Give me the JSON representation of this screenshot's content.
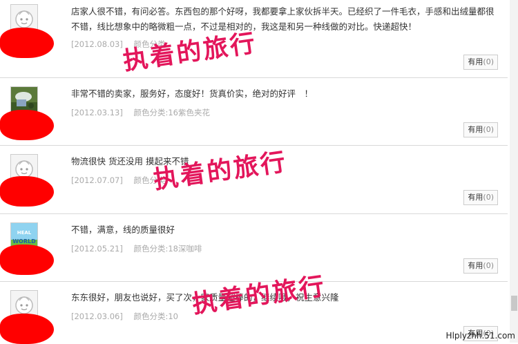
{
  "reviews": [
    {
      "text": "店家人很不错，有问必答。东西包的那个好呀，我都要拿上家伙拆半天。已经织了一件毛衣，手感和出绒量都很不错，线比想象中的略微粗一点，不过是相对的，我这是和另一种线做的对比。快递超快！",
      "date": "[2012.08.03]",
      "attr": "颜色分类:",
      "helpful_label": "有用",
      "helpful_count": "(0)",
      "avatar": "default-avatar-icon"
    },
    {
      "text": "非常不错的卖家，服务好，态度好！货真价实，绝对的好评　！",
      "date": "[2012.03.13]",
      "attr": "颜色分类:16紫色夹花",
      "helpful_label": "有用",
      "helpful_count": "(0)",
      "avatar": "photo-avatar-icon"
    },
    {
      "text": "物流很快 货还没用 摸起来不错",
      "date": "[2012.07.07]",
      "attr": "颜色分类:",
      "helpful_label": "有用",
      "helpful_count": "(0)",
      "avatar": "default-avatar-icon"
    },
    {
      "text": "不错，满意，线的质量很好",
      "date": "[2012.05.21]",
      "attr": "颜色分类:18深咖啡",
      "helpful_label": "有用",
      "helpful_count": "(0)",
      "avatar": "world-avatar-icon"
    },
    {
      "text": "东东很好，朋友也说好，买了次，家质量超棒的，继续哦，祝生意兴隆",
      "date": "[2012.03.06]",
      "attr": "颜色分类:10",
      "helpful_label": "有用",
      "helpful_count": "(0)",
      "avatar": "default-avatar-icon"
    }
  ],
  "watermark": "执着的旅行",
  "site_mark": "Hlplyzhh.51.com",
  "colors": {
    "watermark": "#e3165b",
    "redaction": "#ff0000",
    "meta_text": "#aaaaaa"
  }
}
